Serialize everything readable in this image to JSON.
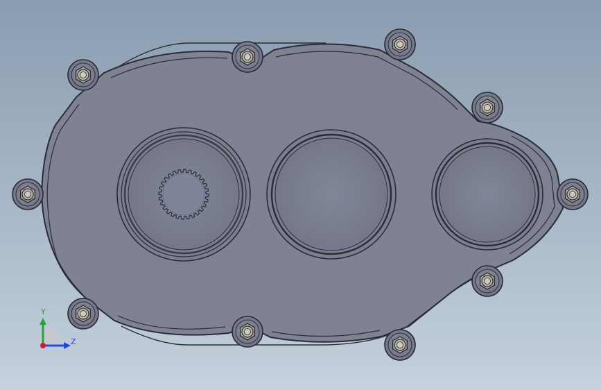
{
  "viewport": {
    "background_top": "#8a9cb0",
    "background_bottom": "#c5d1dc"
  },
  "model": {
    "shell_color": "#7e8293",
    "edge_color": "#2a2c35",
    "boss_color": "#82869a",
    "bolt_head_color": "#b7b2a7",
    "bolt_count": 10,
    "bearing_bore_count": 3,
    "spline_count": 1
  },
  "triad": {
    "y_label": "Y",
    "z_label": "Z",
    "y_color": "#1aa830",
    "z_color": "#1f4fd0",
    "x_color": "#d01f1f"
  }
}
